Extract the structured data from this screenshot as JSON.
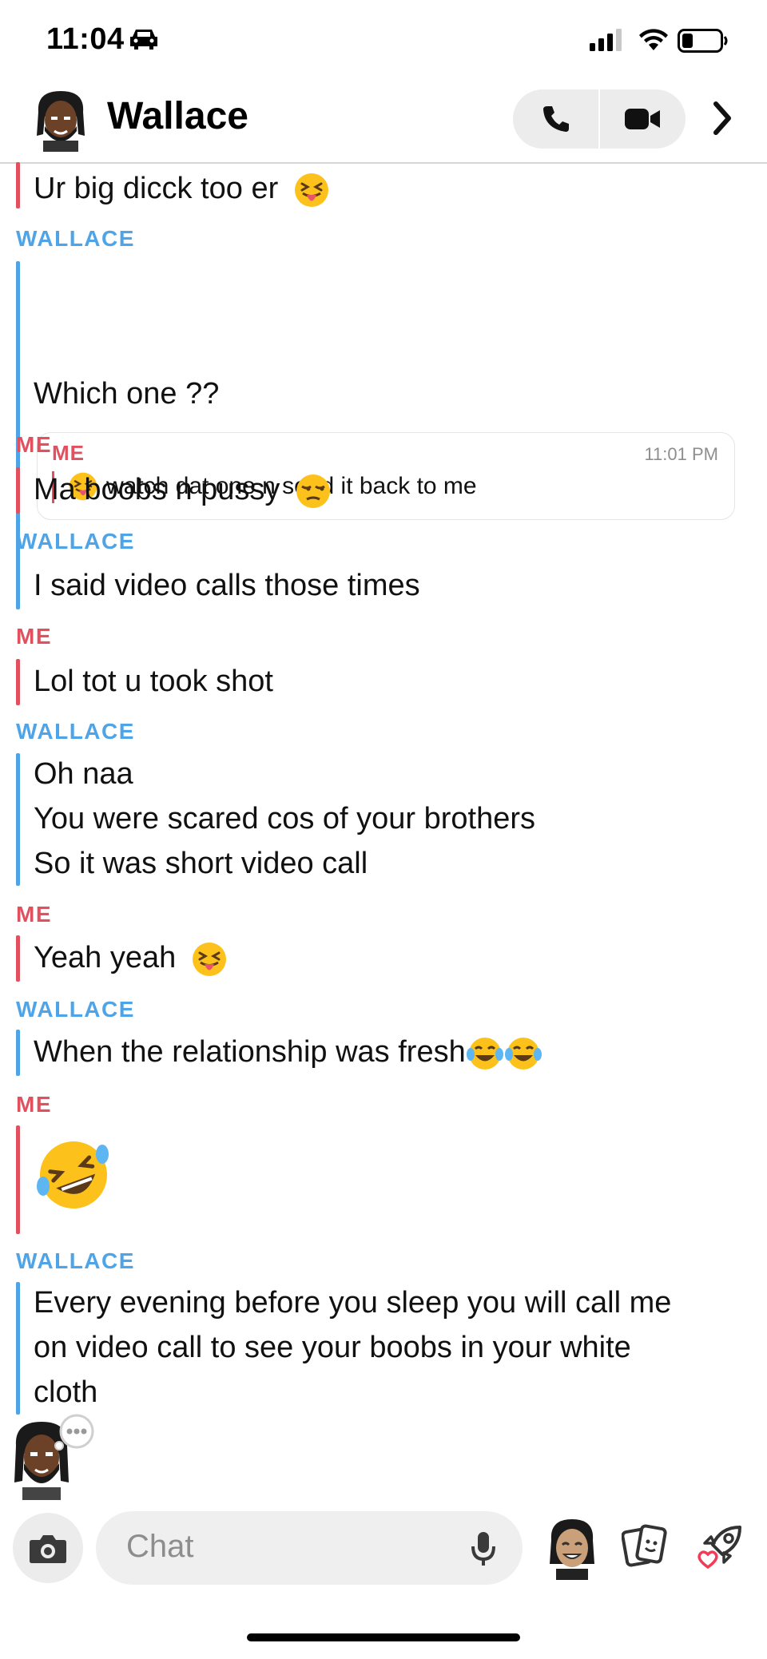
{
  "status_bar": {
    "time": "11:04"
  },
  "header": {
    "contact_name": "Wallace"
  },
  "quote": {
    "sender": "ME",
    "time": "11:01 PM",
    "text": "watch dat one n send it back to me"
  },
  "messages": [
    {
      "sender": "",
      "text": "Ur big dicck too er"
    },
    {
      "sender": "WALLACE",
      "text": "Which one ??"
    },
    {
      "sender": "ME",
      "text": "Ma boobs n pussy"
    },
    {
      "sender": "WALLACE",
      "text": "I said video calls those times"
    },
    {
      "sender": "ME",
      "text": "Lol tot u took shot"
    },
    {
      "sender": "WALLACE",
      "lines": [
        "Oh naa",
        "You were scared cos of your brothers",
        "So it was short video call"
      ]
    },
    {
      "sender": "ME",
      "text": "Yeah yeah"
    },
    {
      "sender": "WALLACE",
      "text": "When the relationship was fresh"
    },
    {
      "sender": "ME",
      "text": ""
    },
    {
      "sender": "WALLACE",
      "lines": [
        "Every evening before you sleep you will call me",
        "on video call to see your boobs in your white",
        "cloth"
      ]
    }
  ],
  "composer": {
    "placeholder": "Chat"
  },
  "colors": {
    "me": "#e0505f",
    "wallace": "#4ea4e6"
  }
}
